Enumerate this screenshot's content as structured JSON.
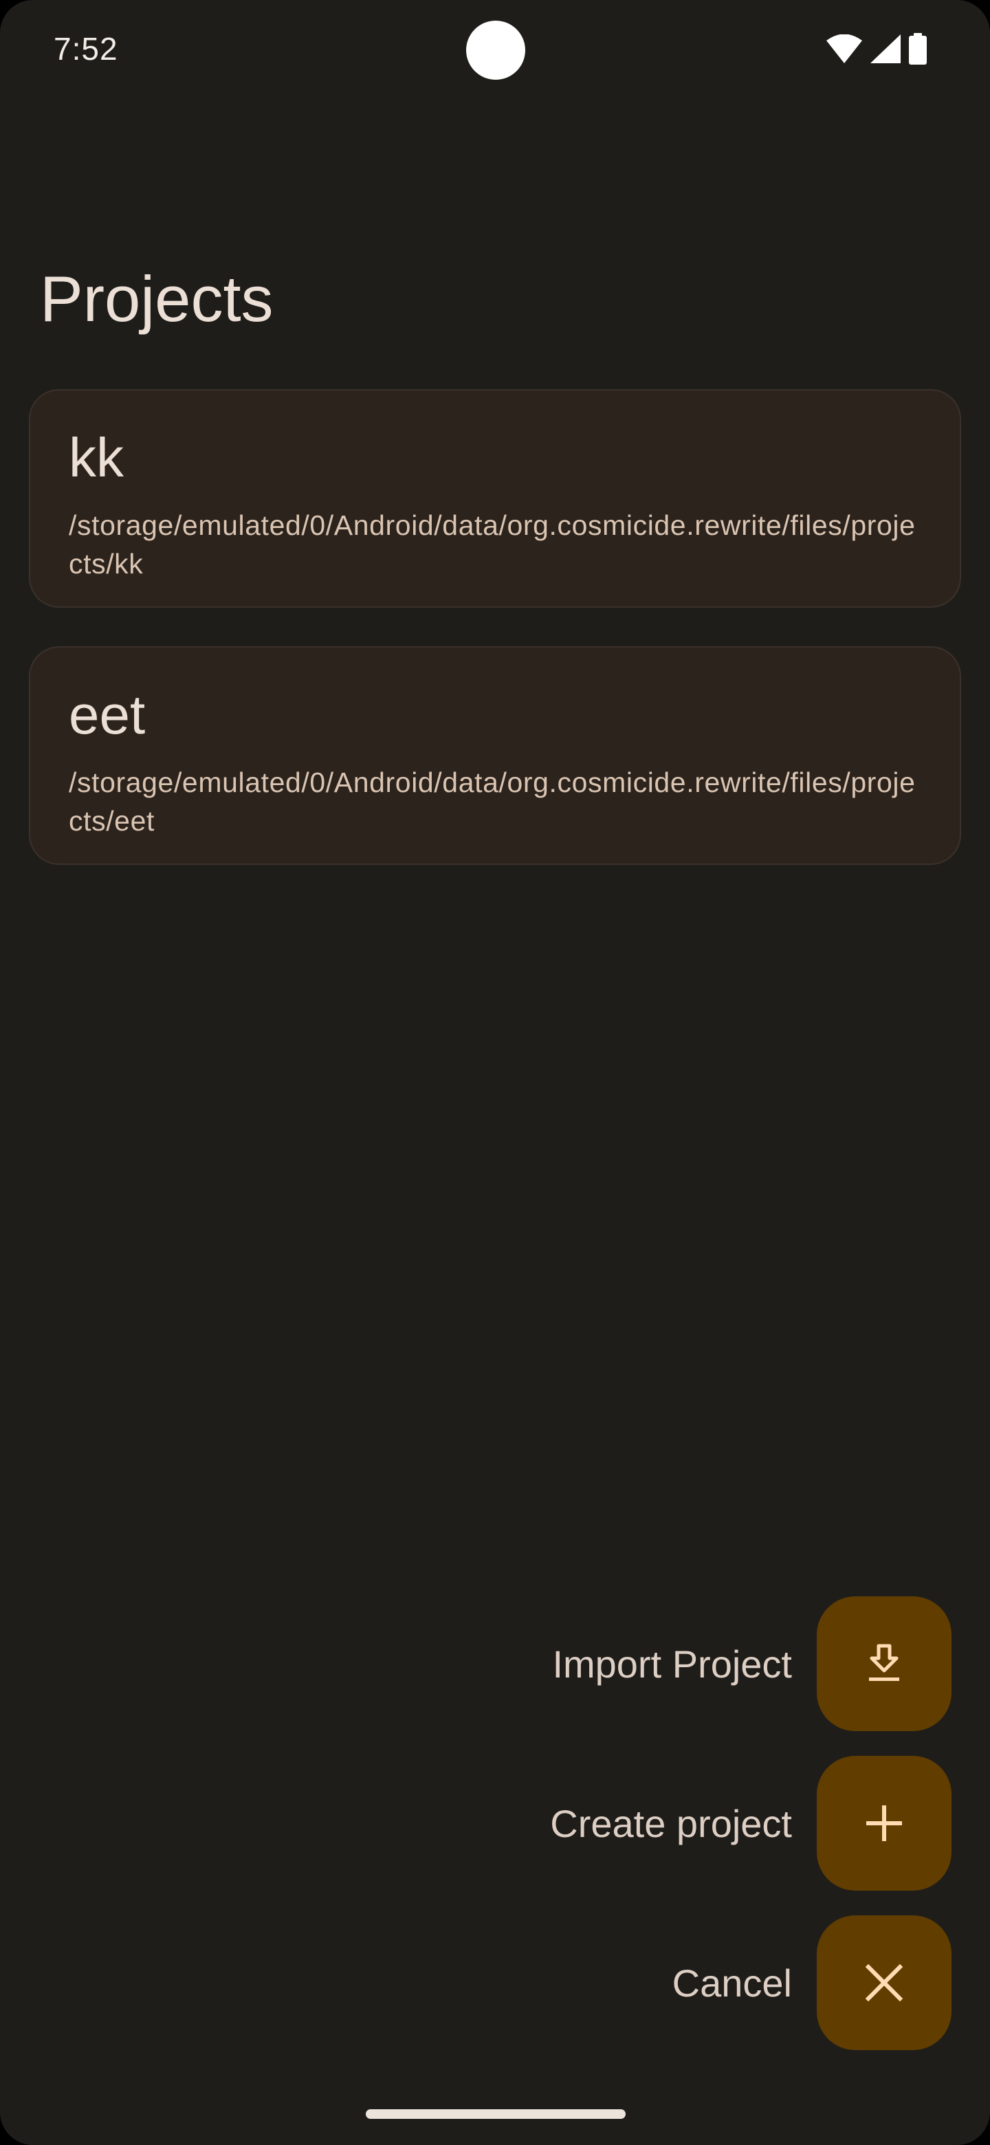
{
  "status_bar": {
    "time": "7:52",
    "icons": [
      "wifi-icon",
      "signal-icon",
      "battery-icon"
    ]
  },
  "title": "Projects",
  "projects": [
    {
      "name": "kk",
      "path": "/storage/emulated/0/Android/data/org.cosmicide.rewrite/files/projects/kk"
    },
    {
      "name": "eet",
      "path": "/storage/emulated/0/Android/data/org.cosmicide.rewrite/files/projects/eet"
    }
  ],
  "fab_menu": {
    "import": {
      "label": "Import Project",
      "icon": "download-icon"
    },
    "create": {
      "label": "Create project",
      "icon": "plus-icon"
    },
    "cancel": {
      "label": "Cancel",
      "icon": "close-icon"
    }
  },
  "colors": {
    "background": "#1f1d1a",
    "card": "#2b231c",
    "fab": "#613e00",
    "fab_icon": "#ffdcb3",
    "text": "#ece0d6"
  }
}
